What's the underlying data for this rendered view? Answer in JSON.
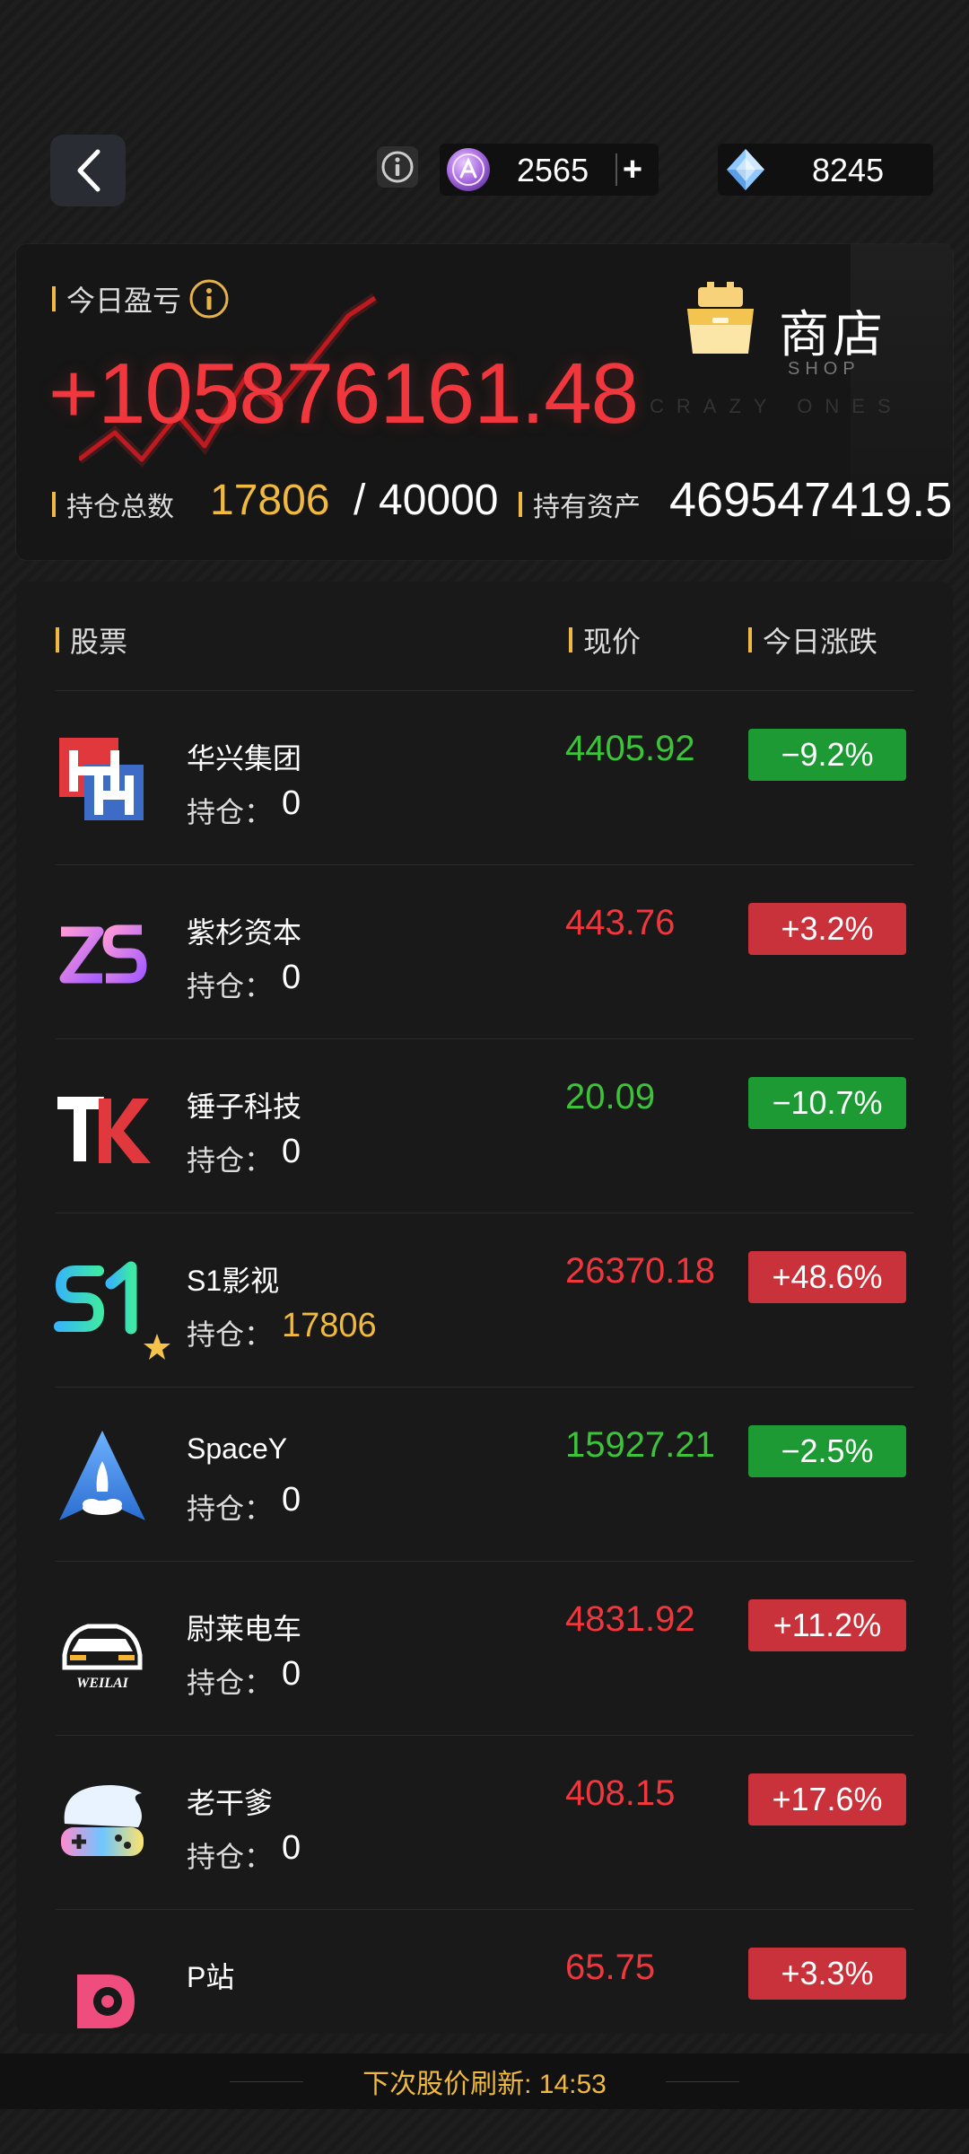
{
  "topbar": {
    "coins": "2565",
    "plus": "+",
    "gems": "8245"
  },
  "summary": {
    "pnl_label": "今日盈亏",
    "pnl_value": "+105876161.48",
    "shop_title": "商店",
    "shop_sub": "SHOP",
    "watermark": "CRAZY ONES",
    "position_label": "持仓总数",
    "position_current": "17806",
    "position_separator": "/",
    "position_max": "40000",
    "assets_label": "持有资产",
    "assets_value": "469547419.52"
  },
  "table": {
    "headers": {
      "stock": "股票",
      "price": "现价",
      "change": "今日涨跌"
    },
    "holding_label": "持仓：",
    "rows": [
      {
        "name": "华兴集团",
        "holding": "0",
        "price": "4405.92",
        "change": "−9.2%",
        "trend": "down",
        "logo": "huaxing-logo"
      },
      {
        "name": "紫杉资本",
        "holding": "0",
        "price": "443.76",
        "change": "+3.2%",
        "trend": "up",
        "logo": "zishan-logo"
      },
      {
        "name": "锤子科技",
        "holding": "0",
        "price": "20.09",
        "change": "−10.7%",
        "trend": "down",
        "logo": "chuizi-logo"
      },
      {
        "name": "S1影视",
        "holding": "17806",
        "price": "26370.18",
        "change": "+48.6%",
        "trend": "up",
        "logo": "s1-logo",
        "favorite": true
      },
      {
        "name": "SpaceY",
        "holding": "0",
        "price": "15927.21",
        "change": "−2.5%",
        "trend": "down",
        "logo": "spacey-logo"
      },
      {
        "name": "尉莱电车",
        "holding": "0",
        "price": "4831.92",
        "change": "+11.2%",
        "trend": "up",
        "logo": "weilai-logo",
        "logo_text": "WEILAI"
      },
      {
        "name": "老干爹",
        "holding": "0",
        "price": "408.15",
        "change": "+17.6%",
        "trend": "up",
        "logo": "laogandie-logo"
      },
      {
        "name": "P站",
        "holding": "",
        "price": "65.75",
        "change": "+3.3%",
        "trend": "up",
        "logo": "pzhan-logo"
      }
    ]
  },
  "footer": {
    "refresh_text": "下次股价刷新: 14:53"
  },
  "colors": {
    "up": "#f0373d",
    "down": "#3dc33a",
    "accent": "#f0b940",
    "badge_up": "#c9323a",
    "badge_down": "#1e9a35"
  }
}
